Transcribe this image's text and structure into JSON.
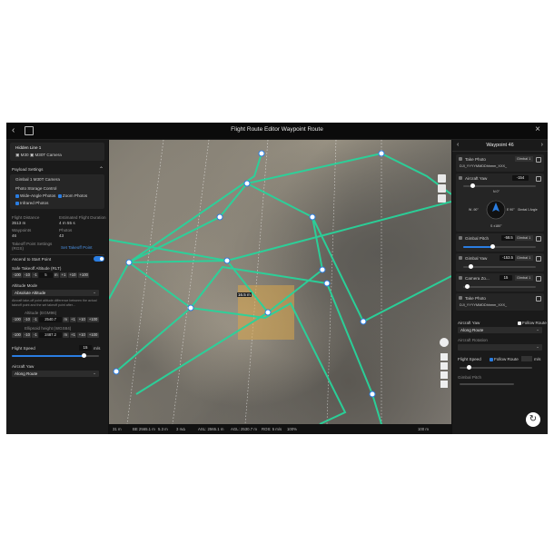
{
  "window": {
    "title": "Flight Route Editor Waypoint Route"
  },
  "left_panel": {
    "route_name": "Hidden Line 1",
    "drone": "M30",
    "camera": "M30T Camera",
    "payload_section": "Payload Settings",
    "gimbal": "Gimbal 1 M30T Camera",
    "photo_storage": "Photo Storage Control",
    "photo_options": [
      "Wide-Angle Photos",
      "Zoom Photos",
      "Infrared Photos"
    ],
    "stats": [
      {
        "label": "Flight Distance",
        "value": "3513 m"
      },
      {
        "label": "Estimated Flight Duration",
        "value": "4 m 55 s"
      },
      {
        "label": "Waypoints",
        "value": "46"
      },
      {
        "label": "Photos",
        "value": "43"
      }
    ],
    "takeoff_point": "Takeoff Point Settings (RGS)",
    "set_takeoff": "Set Takeoff Point",
    "ascend_label": "Ascend to Start Point",
    "safe_takeoff_label": "Safe Takeoff Altitude (RLT)",
    "safe_takeoff_steps": [
      "-100",
      "-10",
      "-1",
      "5",
      "m",
      "+1",
      "+10",
      "+100"
    ],
    "altitude_mode_label": "Altitude Mode",
    "altitude_mode": "Absolute Altitude",
    "altitude_hint": "Aircraft take-off point altitude difference between the actual takeoff point and the set takeoff point after...",
    "altitude_label": "Altitude (EGM96)",
    "altitude_steps": [
      "-100",
      "-10",
      "-1",
      "2540.7",
      "m",
      "+1",
      "+10",
      "+100"
    ],
    "ellipsoid_label": "Ellipsoid height (WGS84)",
    "ellipsoid_steps": [
      "-100",
      "-10",
      "-1",
      "2487.2",
      "m",
      "+1",
      "+10",
      "+100"
    ],
    "speed_label": "Flight Speed",
    "speed_value": "15",
    "speed_unit": "m/s",
    "yaw_label": "Aircraft Yaw",
    "yaw_value": "Along Route"
  },
  "map": {
    "distance_tag": "16.5 m",
    "bottom_bar": [
      "31 m",
      "BE 2565.1 m",
      "5.3 m",
      "3 mΔ",
      "ASL: 2565.1 m",
      "AGL: 2530.7 m",
      "ROS: 5 m/s",
      "100%",
      "100 m"
    ]
  },
  "right_panel": {
    "title": "Waypoint 46",
    "actions": [
      {
        "label": "Take Photo",
        "dropdown": "Gimbal 1"
      },
      {
        "label": "Aircraft Yaw",
        "value": "-154"
      },
      {
        "label": "Gimbal Pitch",
        "value": "-58.5",
        "dropdown": "Gimbal 1"
      },
      {
        "label": "Gimbal Yaw",
        "value": "-153.5",
        "dropdown": "Gimbal 1"
      },
      {
        "label": "Camera Zo...",
        "value": "15",
        "dropdown": "Gimbal 1"
      },
      {
        "label": "Take Photo",
        "file": "DJI_YYYYMMDDhhmm_XXX_"
      }
    ],
    "first_file": "DJI_YYYYMMDDhhmm_XXX_",
    "compass": {
      "n": "N 0°",
      "w": "W -90°",
      "e": "E 90°",
      "s": "S ±180°",
      "gimbal": "Gimbal 1 Angle"
    },
    "aircraft_yaw_label": "Aircraft Yaw",
    "follow_route": "Follow Route",
    "aircraft_yaw_value": "Along Route",
    "aircraft_rotation_label": "Aircraft Rotation",
    "flight_speed_label": "Flight Speed",
    "follow_route_2": "Follow Route",
    "speed_unit": "m/s",
    "gimbal_pitch_label": "Gimbal Pitch"
  }
}
